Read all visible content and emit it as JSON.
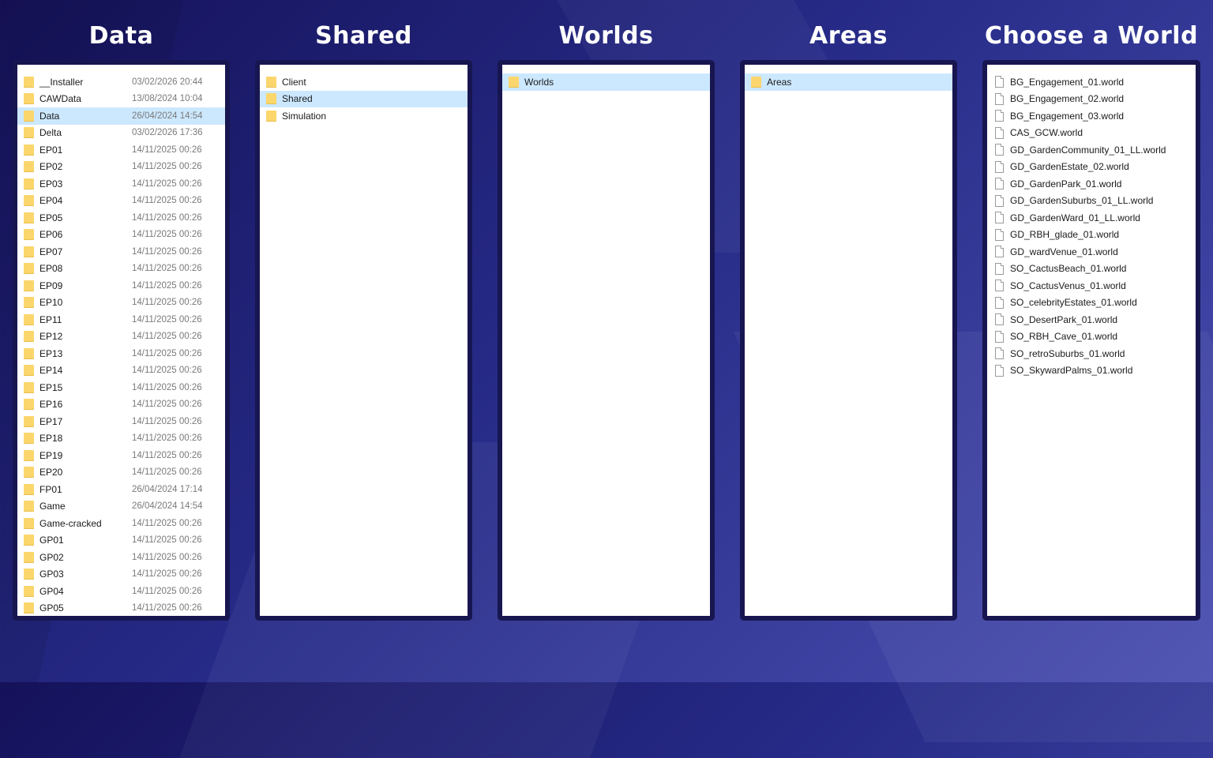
{
  "columns": [
    {
      "title": "Data",
      "selected": "Data",
      "items": [
        {
          "name": "__Installer",
          "date": "03/02/2026 20:44"
        },
        {
          "name": "CAWData",
          "date": "13/08/2024 10:04"
        },
        {
          "name": "Data",
          "date": "26/04/2024 14:54"
        },
        {
          "name": "Delta",
          "date": "03/02/2026 17:36"
        },
        {
          "name": "EP01",
          "date": "14/11/2025 00:26"
        },
        {
          "name": "EP02",
          "date": "14/11/2025 00:26"
        },
        {
          "name": "EP03",
          "date": "14/11/2025 00:26"
        },
        {
          "name": "EP04",
          "date": "14/11/2025 00:26"
        },
        {
          "name": "EP05",
          "date": "14/11/2025 00:26"
        },
        {
          "name": "EP06",
          "date": "14/11/2025 00:26"
        },
        {
          "name": "EP07",
          "date": "14/11/2025 00:26"
        },
        {
          "name": "EP08",
          "date": "14/11/2025 00:26"
        },
        {
          "name": "EP09",
          "date": "14/11/2025 00:26"
        },
        {
          "name": "EP10",
          "date": "14/11/2025 00:26"
        },
        {
          "name": "EP11",
          "date": "14/11/2025 00:26"
        },
        {
          "name": "EP12",
          "date": "14/11/2025 00:26"
        },
        {
          "name": "EP13",
          "date": "14/11/2025 00:26"
        },
        {
          "name": "EP14",
          "date": "14/11/2025 00:26"
        },
        {
          "name": "EP15",
          "date": "14/11/2025 00:26"
        },
        {
          "name": "EP16",
          "date": "14/11/2025 00:26"
        },
        {
          "name": "EP17",
          "date": "14/11/2025 00:26"
        },
        {
          "name": "EP18",
          "date": "14/11/2025 00:26"
        },
        {
          "name": "EP19",
          "date": "14/11/2025 00:26"
        },
        {
          "name": "EP20",
          "date": "14/11/2025 00:26"
        },
        {
          "name": "FP01",
          "date": "26/04/2024 17:14"
        },
        {
          "name": "Game",
          "date": "26/04/2024 14:54"
        },
        {
          "name": "Game-cracked",
          "date": "14/11/2025 00:26"
        },
        {
          "name": "GP01",
          "date": "14/11/2025 00:26"
        },
        {
          "name": "GP02",
          "date": "14/11/2025 00:26"
        },
        {
          "name": "GP03",
          "date": "14/11/2025 00:26"
        },
        {
          "name": "GP04",
          "date": "14/11/2025 00:26"
        },
        {
          "name": "GP05",
          "date": "14/11/2025 00:26"
        }
      ]
    },
    {
      "title": "Shared",
      "selected": "Shared",
      "items": [
        {
          "name": "Client"
        },
        {
          "name": "Shared"
        },
        {
          "name": "Simulation"
        }
      ]
    },
    {
      "title": "Worlds",
      "selected": "Worlds",
      "items": [
        {
          "name": "Worlds"
        }
      ]
    },
    {
      "title": "Areas",
      "selected": "Areas",
      "items": [
        {
          "name": "Areas"
        }
      ]
    },
    {
      "title": "Choose a World",
      "selected": "",
      "items": [
        {
          "name": "BG_Engagement_01.world"
        },
        {
          "name": "BG_Engagement_02.world"
        },
        {
          "name": "BG_Engagement_03.world"
        },
        {
          "name": "CAS_GCW.world"
        },
        {
          "name": "GD_GardenCommunity_01_LL.world"
        },
        {
          "name": "GD_GardenEstate_02.world"
        },
        {
          "name": "GD_GardenPark_01.world"
        },
        {
          "name": "GD_GardenSuburbs_01_LL.world"
        },
        {
          "name": "GD_GardenWard_01_LL.world"
        },
        {
          "name": "GD_RBH_glade_01.world"
        },
        {
          "name": "GD_wardVenue_01.world"
        },
        {
          "name": "SO_CactusBeach_01.world"
        },
        {
          "name": "SO_CactusVenus_01.world"
        },
        {
          "name": "SO_celebrityEstates_01.world"
        },
        {
          "name": "SO_DesertPark_01.world"
        },
        {
          "name": "SO_RBH_Cave_01.world"
        },
        {
          "name": "SO_retroSuburbs_01.world"
        },
        {
          "name": "SO_SkywardPalms_01.world"
        }
      ]
    }
  ],
  "icons": {
    "folder": "folder-icon",
    "file": "file-icon"
  },
  "colors": {
    "selection": "#cce8ff",
    "folder": "#fbd66c",
    "background": "#262a86"
  }
}
